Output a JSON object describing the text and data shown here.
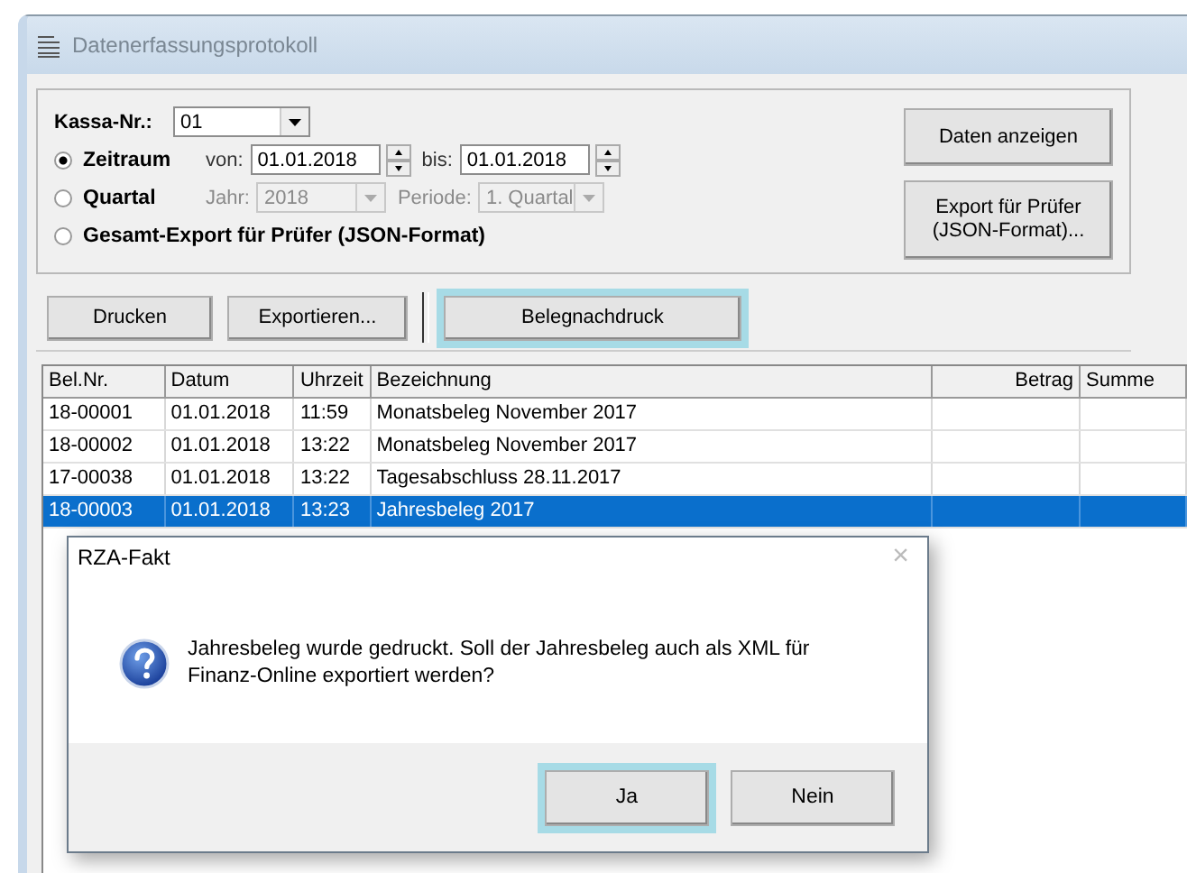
{
  "window": {
    "title": "Datenerfassungsprotokoll"
  },
  "filter": {
    "kassa": {
      "label": "Kassa-Nr.:",
      "value": "01"
    },
    "options": [
      {
        "label": "Zeitraum",
        "selected": true,
        "fields": [
          {
            "kind": "spin",
            "label": "von:",
            "value": "01.01.2018",
            "disabled": false
          },
          {
            "kind": "spin",
            "label": "bis:",
            "value": "01.01.2018",
            "disabled": false
          }
        ]
      },
      {
        "label": "Quartal",
        "selected": false,
        "fields": [
          {
            "kind": "combo",
            "label": "Jahr:",
            "value": "2018",
            "disabled": true
          },
          {
            "kind": "combo",
            "label": "Periode:",
            "value": "1. Quartal",
            "disabled": true
          }
        ]
      },
      {
        "label": "Gesamt-Export für Prüfer (JSON-Format)",
        "selected": false
      }
    ]
  },
  "side_buttons": [
    "Daten anzeigen",
    "Export für Prüfer (JSON-Format)..."
  ],
  "toolbar": [
    {
      "label": "Drucken",
      "highlighted": false
    },
    {
      "label": "Exportieren...",
      "highlighted": false
    },
    {
      "label": "Belegnachdruck",
      "highlighted": true
    }
  ],
  "table": {
    "columns": [
      {
        "label": "Bel.Nr."
      },
      {
        "label": "Datum"
      },
      {
        "label": "Uhrzeit"
      },
      {
        "label": "Bezeichnung"
      },
      {
        "label": "Betrag"
      },
      {
        "label": "Summe"
      }
    ],
    "rows": [
      {
        "cells": [
          "18-00001",
          "01.01.2018",
          "11:59",
          "Monatsbeleg November 2017"
        ],
        "selected": false
      },
      {
        "cells": [
          "18-00002",
          "01.01.2018",
          "13:22",
          "Monatsbeleg November 2017"
        ],
        "selected": false
      },
      {
        "cells": [
          "17-00038",
          "01.01.2018",
          "13:22",
          "Tagesabschluss 28.11.2017"
        ],
        "selected": false
      },
      {
        "cells": [
          "18-00003",
          "01.01.2018",
          "13:23",
          "Jahresbeleg 2017"
        ],
        "selected": true
      }
    ]
  },
  "dialog": {
    "title": "RZA-Fakt",
    "close": "×",
    "message": "Jahresbeleg wurde gedruckt. Soll der Jahresbeleg auch als XML für Finanz-Online exportiert werden?",
    "buttons": [
      {
        "label": "Ja",
        "highlighted": true
      },
      {
        "label": "Nein",
        "highlighted": false
      }
    ]
  }
}
